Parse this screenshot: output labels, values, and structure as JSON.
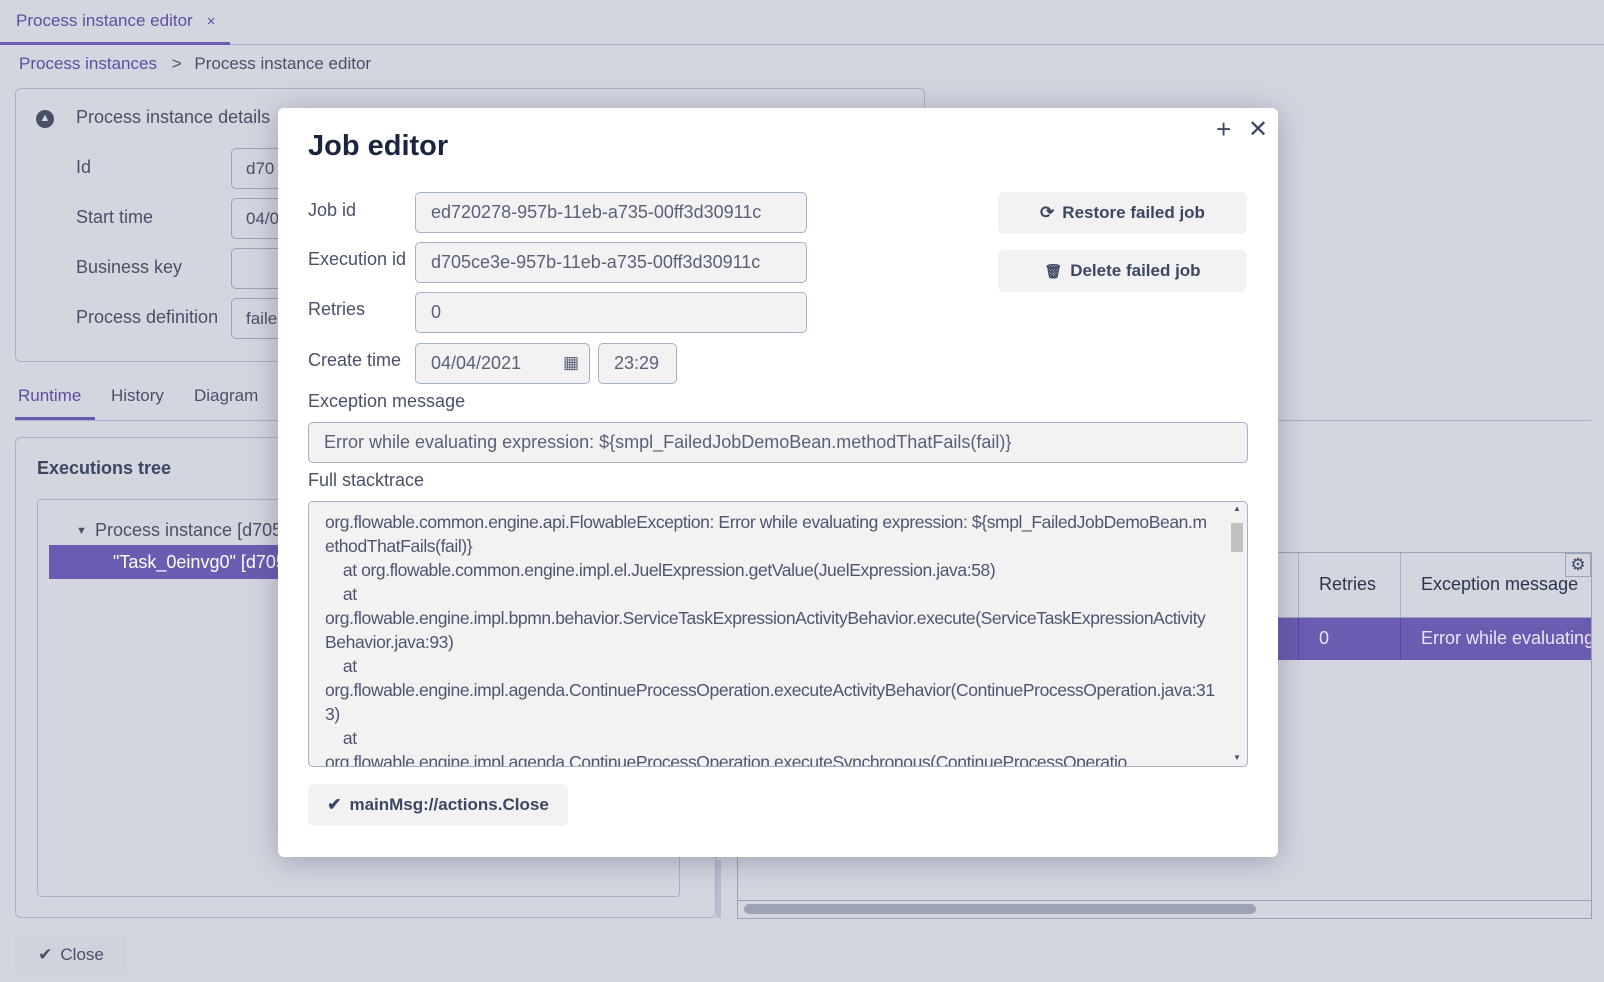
{
  "tabbar": {
    "tab_label": "Process instance editor",
    "tab_close": "×"
  },
  "breadcrumb": {
    "parent": "Process instances",
    "separator": ">",
    "current": "Process instance editor"
  },
  "details": {
    "title": "Process instance details",
    "fields": [
      {
        "label": "Id",
        "value": "d70"
      },
      {
        "label": "Start time",
        "value": "04/0"
      },
      {
        "label": "Business key",
        "value": ""
      },
      {
        "label": "Process definition",
        "value": "faile"
      }
    ]
  },
  "runtime_tabs": [
    "Runtime",
    "History",
    "Diagram"
  ],
  "executions": {
    "title": "Executions tree",
    "items": [
      {
        "label": "Process instance [d705"
      },
      {
        "label": "\"Task_0einvg0\" [d705"
      }
    ]
  },
  "jobs_table": {
    "columns": [
      "Retries",
      "Exception message"
    ],
    "rows": [
      {
        "retries": "0",
        "exception": "Error while evaluating"
      }
    ]
  },
  "footer": {
    "close_label": "Close"
  },
  "modal": {
    "title": "Job editor",
    "labels": {
      "job_id": "Job id",
      "execution_id": "Execution id",
      "retries": "Retries",
      "create_time": "Create time",
      "exception": "Exception message",
      "stacktrace": "Full stacktrace"
    },
    "values": {
      "job_id": "ed720278-957b-11eb-a735-00ff3d30911c",
      "execution_id": "d705ce3e-957b-11eb-a735-00ff3d30911c",
      "retries": "0",
      "create_date": "04/04/2021",
      "create_time": "23:29",
      "exception": "Error while evaluating expression: ${smpl_FailedJobDemoBean.methodThatFails(fail)}",
      "stacktrace": "org.flowable.common.engine.api.FlowableException: Error while evaluating expression: ${smpl_FailedJobDemoBean.methodThatFails(fail)}\n\tat org.flowable.common.engine.impl.el.JuelExpression.getValue(JuelExpression.java:58)\n\tat\norg.flowable.engine.impl.bpmn.behavior.ServiceTaskExpressionActivityBehavior.execute(ServiceTaskExpressionActivityBehavior.java:93)\n\tat\norg.flowable.engine.impl.agenda.ContinueProcessOperation.executeActivityBehavior(ContinueProcessOperation.java:313)\n\tat\norg.flowable.engine.impl.agenda.ContinueProcessOperation.executeSynchronous(ContinueProcessOperatio"
    },
    "buttons": {
      "restore": "Restore failed job",
      "delete": "Delete failed job",
      "close": "mainMsg://actions.Close"
    }
  },
  "colors": {
    "accent": "#6a5cb0",
    "background": "#d3d6df",
    "input_bg": "#f2f2f2"
  }
}
